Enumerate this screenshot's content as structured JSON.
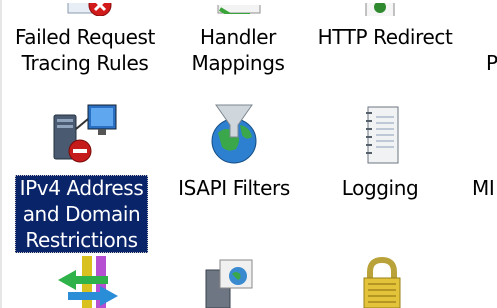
{
  "features": [
    {
      "id": "failed-request",
      "label_lines": [
        "Failed Request",
        "Tracing Rules"
      ],
      "icon": "failed-request-icon"
    },
    {
      "id": "handler-mappings",
      "label_lines": [
        "Handler",
        "Mappings"
      ],
      "icon": "handler-mappings-icon"
    },
    {
      "id": "http-redirect",
      "label_lines": [
        "HTTP Redirect"
      ],
      "icon": "http-redirect-icon"
    },
    {
      "id": "partial-4",
      "label_lines": [
        "P"
      ],
      "icon": "partial-icon"
    },
    {
      "id": "ipv4",
      "label_lines": [
        "IPv4 Address",
        "and Domain",
        "Restrictions"
      ],
      "icon": "ipv4-restrictions-icon",
      "selected": true
    },
    {
      "id": "isapi",
      "label_lines": [
        "ISAPI Filters"
      ],
      "icon": "isapi-filters-icon"
    },
    {
      "id": "logging",
      "label_lines": [
        "Logging"
      ],
      "icon": "logging-icon"
    },
    {
      "id": "partial-8",
      "label_lines": [
        "MI"
      ],
      "icon": "partial-icon"
    }
  ],
  "colors": {
    "selection_bg": "#0a246a",
    "selection_text": "#ffffff"
  }
}
